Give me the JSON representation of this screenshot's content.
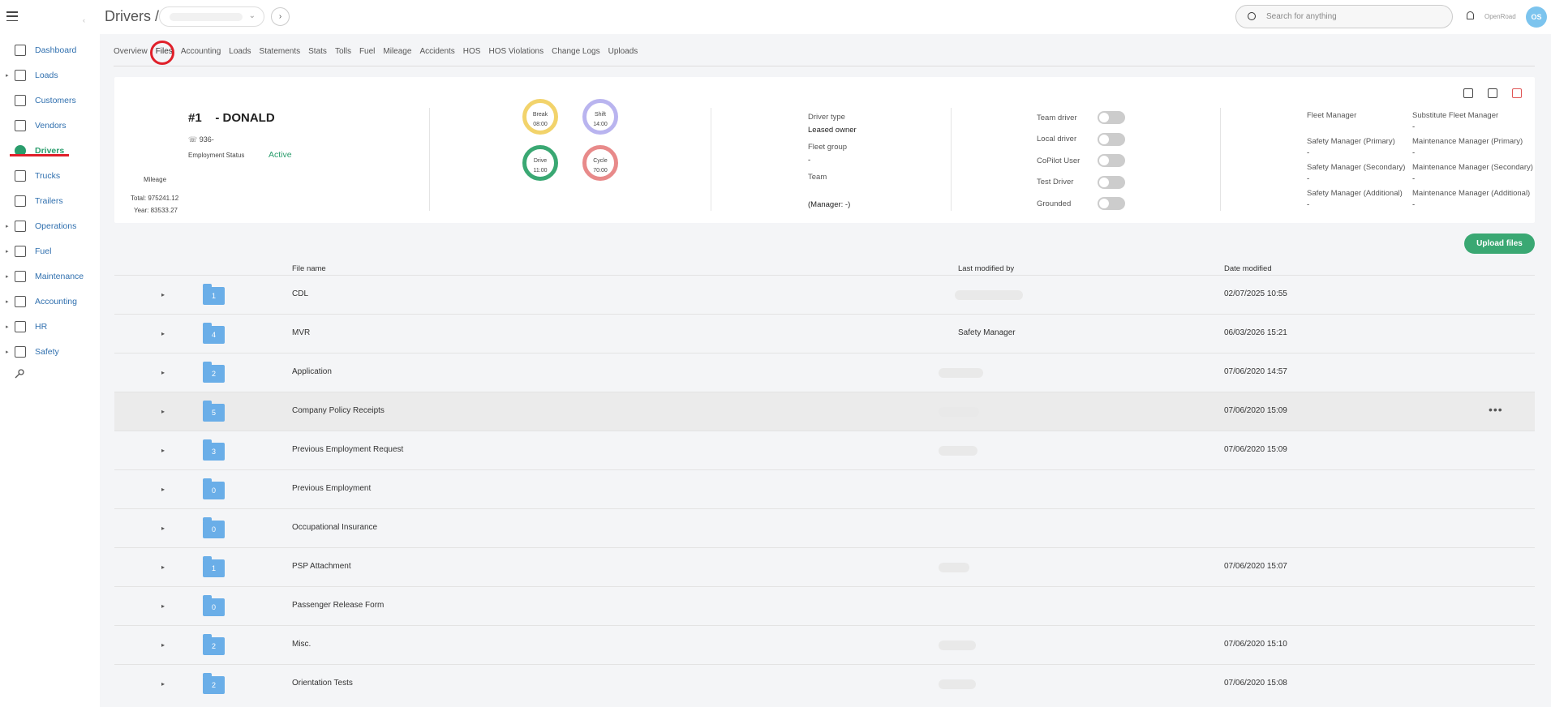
{
  "header": {
    "title": "Drivers /",
    "search_placeholder": "Search for anything",
    "brand": "OpenRoad",
    "avatar_initials": "OS"
  },
  "sidebar": {
    "items": [
      {
        "label": "Dashboard",
        "caret": false,
        "active": false
      },
      {
        "label": "Loads",
        "caret": true,
        "active": false
      },
      {
        "label": "Customers",
        "caret": false,
        "active": false
      },
      {
        "label": "Vendors",
        "caret": false,
        "active": false
      },
      {
        "label": "Drivers",
        "caret": false,
        "active": true
      },
      {
        "label": "Trucks",
        "caret": false,
        "active": false
      },
      {
        "label": "Trailers",
        "caret": false,
        "active": false
      },
      {
        "label": "Operations",
        "caret": true,
        "active": false
      },
      {
        "label": "Fuel",
        "caret": true,
        "active": false
      },
      {
        "label": "Maintenance",
        "caret": true,
        "active": false
      },
      {
        "label": "Accounting",
        "caret": true,
        "active": false
      },
      {
        "label": "HR",
        "caret": true,
        "active": false
      },
      {
        "label": "Safety",
        "caret": true,
        "active": false
      }
    ]
  },
  "tabs": [
    "Overview",
    "Files",
    "Accounting",
    "Loads",
    "Statements",
    "Stats",
    "Tolls",
    "Fuel",
    "Mileage",
    "Accidents",
    "HOS",
    "HOS Violations",
    "Change Logs",
    "Uploads"
  ],
  "active_tab": "Files",
  "driver": {
    "id": "#1",
    "name": "- DONALD",
    "phone": "936-",
    "employment_status_label": "Employment Status",
    "employment_status": "Active",
    "mileage_label": "Mileage",
    "mileage_total": "Total: 975241.12",
    "mileage_year": "Year: 83533.27"
  },
  "gauges": [
    {
      "label": "Break",
      "value": "08:00",
      "color": "#f2d36b"
    },
    {
      "label": "Shift",
      "value": "14:00",
      "color": "#b9b4ef"
    },
    {
      "label": "Drive",
      "value": "11:00",
      "color": "#3aa873"
    },
    {
      "label": "Cycle",
      "value": "70:00",
      "color": "#e88a8a"
    }
  ],
  "info": {
    "driver_type_label": "Driver type",
    "driver_type": "Leased owner",
    "fleet_group_label": "Fleet group",
    "fleet_group": "-",
    "team_label": "Team",
    "manager": "(Manager: -)"
  },
  "toggles": [
    "Team driver",
    "Local driver",
    "CoPilot User",
    "Test Driver",
    "Grounded"
  ],
  "managers": {
    "fleet_manager": "Fleet Manager",
    "substitute_fleet_manager": "Substitute Fleet Manager",
    "safety_primary": "Safety Manager (Primary)",
    "maintenance_primary": "Maintenance Manager (Primary)",
    "safety_secondary": "Safety Manager (Secondary)",
    "maintenance_secondary": "Maintenance Manager (Secondary)",
    "safety_additional": "Safety Manager (Additional)",
    "maintenance_additional": "Maintenance Manager (Additional)",
    "dash": "-"
  },
  "upload_label": "Upload files",
  "table": {
    "headers": {
      "file_name": "File name",
      "last_modified_by": "Last modified by",
      "date_modified": "Date modified"
    },
    "rows": [
      {
        "count": "1",
        "name": "CDL",
        "modified_by": "",
        "date": "02/07/2025 10:55"
      },
      {
        "count": "4",
        "name": "MVR",
        "modified_by": "Safety Manager",
        "date": "06/03/2026 15:21"
      },
      {
        "count": "2",
        "name": "Application",
        "modified_by": "",
        "date": "07/06/2020 14:57"
      },
      {
        "count": "5",
        "name": "Company Policy Receipts",
        "modified_by": "",
        "date": "07/06/2020 15:09"
      },
      {
        "count": "3",
        "name": "Previous Employment Request",
        "modified_by": "",
        "date": "07/06/2020 15:09"
      },
      {
        "count": "0",
        "name": "Previous Employment",
        "modified_by": "",
        "date": ""
      },
      {
        "count": "0",
        "name": "Occupational Insurance",
        "modified_by": "",
        "date": ""
      },
      {
        "count": "1",
        "name": "PSP Attachment",
        "modified_by": "",
        "date": "07/06/2020 15:07"
      },
      {
        "count": "0",
        "name": "Passenger Release Form",
        "modified_by": "",
        "date": ""
      },
      {
        "count": "2",
        "name": "Misc.",
        "modified_by": "",
        "date": "07/06/2020 15:10"
      },
      {
        "count": "2",
        "name": "Orientation Tests",
        "modified_by": "",
        "date": "07/06/2020 15:08"
      }
    ]
  }
}
